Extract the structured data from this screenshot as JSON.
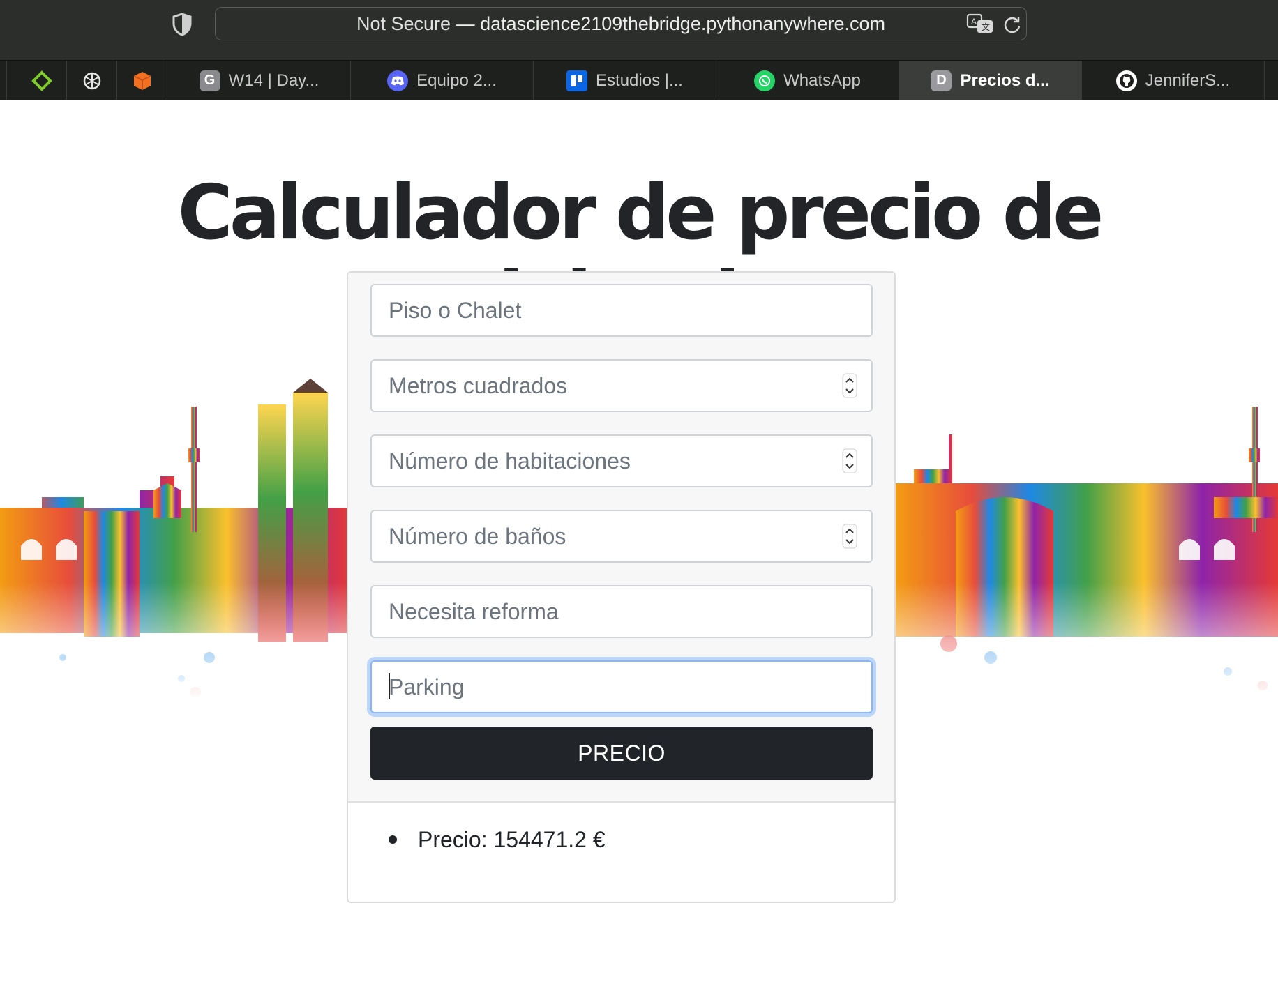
{
  "browser": {
    "url_security": "Not Secure",
    "url_separator": " — ",
    "url_host": "datascience2109thebridge.pythonanywhere.com",
    "tabs": [
      {
        "label": "W14 | Day...",
        "favicon": "G",
        "favicon_color": "#8a8a8e",
        "active": false
      },
      {
        "label": "Equipo 2...",
        "favicon": "discord-icon",
        "favicon_color": "#5865f2",
        "active": false
      },
      {
        "label": "Estudios |...",
        "favicon": "trello-icon",
        "favicon_color": "#0c66e4",
        "active": false
      },
      {
        "label": "WhatsApp",
        "favicon": "whatsapp-icon",
        "favicon_color": "#25d366",
        "active": false
      },
      {
        "label": "Precios d...",
        "favicon": "D",
        "favicon_color": "#9a9a9e",
        "active": true
      },
      {
        "label": "JenniferS...",
        "favicon": "github-icon",
        "favicon_color": "#ffffff",
        "active": false
      }
    ]
  },
  "page": {
    "title": "Calculador de precio de viviendas",
    "form": {
      "tipo_placeholder": "Piso o Chalet",
      "metros_placeholder": "Metros cuadrados",
      "habitaciones_placeholder": "Número de habitaciones",
      "banos_placeholder": "Número de baños",
      "reforma_placeholder": "Necesita reforma",
      "parking_placeholder": "Parking",
      "submit_label": "PRECIO"
    },
    "result_text": "Precio: 154471.2 €"
  },
  "colors": {
    "button_bg": "#212529",
    "focus_ring": "#86b7fe",
    "chrome_bg": "#2c2e2c"
  }
}
